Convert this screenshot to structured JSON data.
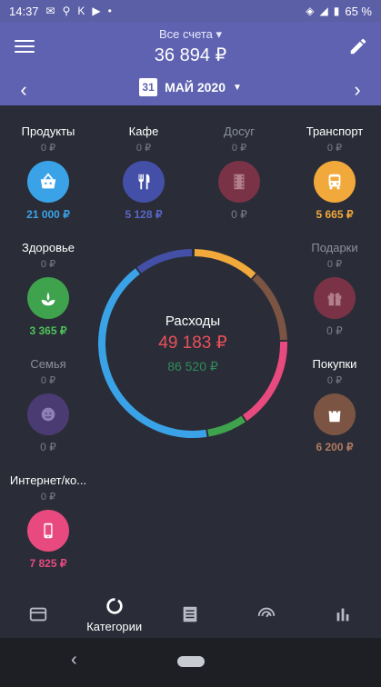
{
  "status_bar": {
    "time": "14:37",
    "letters": "K",
    "battery": "65 %"
  },
  "header": {
    "accounts_label": "Все счета ▾",
    "total": "36 894 ₽",
    "calendar_day": "31",
    "period": "МАЙ 2020"
  },
  "categories": [
    {
      "name": "Продукты",
      "budget": "0 ₽",
      "spent": "21 000 ₽",
      "color": "#3aa3e8",
      "spent_color": "#3aa3e8",
      "icon": "basket-icon"
    },
    {
      "name": "Кафе",
      "budget": "0 ₽",
      "spent": "5 128 ₽",
      "color": "#4450a8",
      "spent_color": "#5866c8",
      "icon": "cutlery-icon"
    },
    {
      "name": "Досуг",
      "budget": "0 ₽",
      "spent": "0 ₽",
      "color": "#7a3346",
      "spent_color": "#7b7e88",
      "icon": "film-icon"
    },
    {
      "name": "Транспорт",
      "budget": "0 ₽",
      "spent": "5 665 ₽",
      "color": "#f2a93b",
      "spent_color": "#f2a93b",
      "icon": "bus-icon"
    },
    {
      "name": "Здоровье",
      "budget": "0 ₽",
      "spent": "3 365 ₽",
      "color": "#3fa34d",
      "spent_color": "#4cc35a",
      "icon": "leaf-icon"
    },
    {
      "name": "Подарки",
      "budget": "0 ₽",
      "spent": "0 ₽",
      "color": "#7a3346",
      "spent_color": "#7b7e88",
      "icon": "gift-icon"
    },
    {
      "name": "Семья",
      "budget": "0 ₽",
      "spent": "0 ₽",
      "color": "#4b3b73",
      "spent_color": "#7b7e88",
      "icon": "baby-icon"
    },
    {
      "name": "Покупки",
      "budget": "0 ₽",
      "spent": "6 200 ₽",
      "color": "#7b5443",
      "spent_color": "#b07a60",
      "icon": "shopping-bag-icon"
    },
    {
      "name": "Интернет/ко...",
      "budget": "0 ₽",
      "spent": "7 825 ₽",
      "color": "#e84a7f",
      "spent_color": "#e84a7f",
      "icon": "phone-icon"
    }
  ],
  "summary": {
    "title": "Расходы",
    "expenses": "49 183 ₽",
    "income": "86 520 ₽"
  },
  "bottom_nav": {
    "active_label": "Категории"
  },
  "colors": {
    "header": "#5e62b0",
    "background": "#2a2d37",
    "expense": "#e9505a",
    "income": "#2e8b57"
  }
}
